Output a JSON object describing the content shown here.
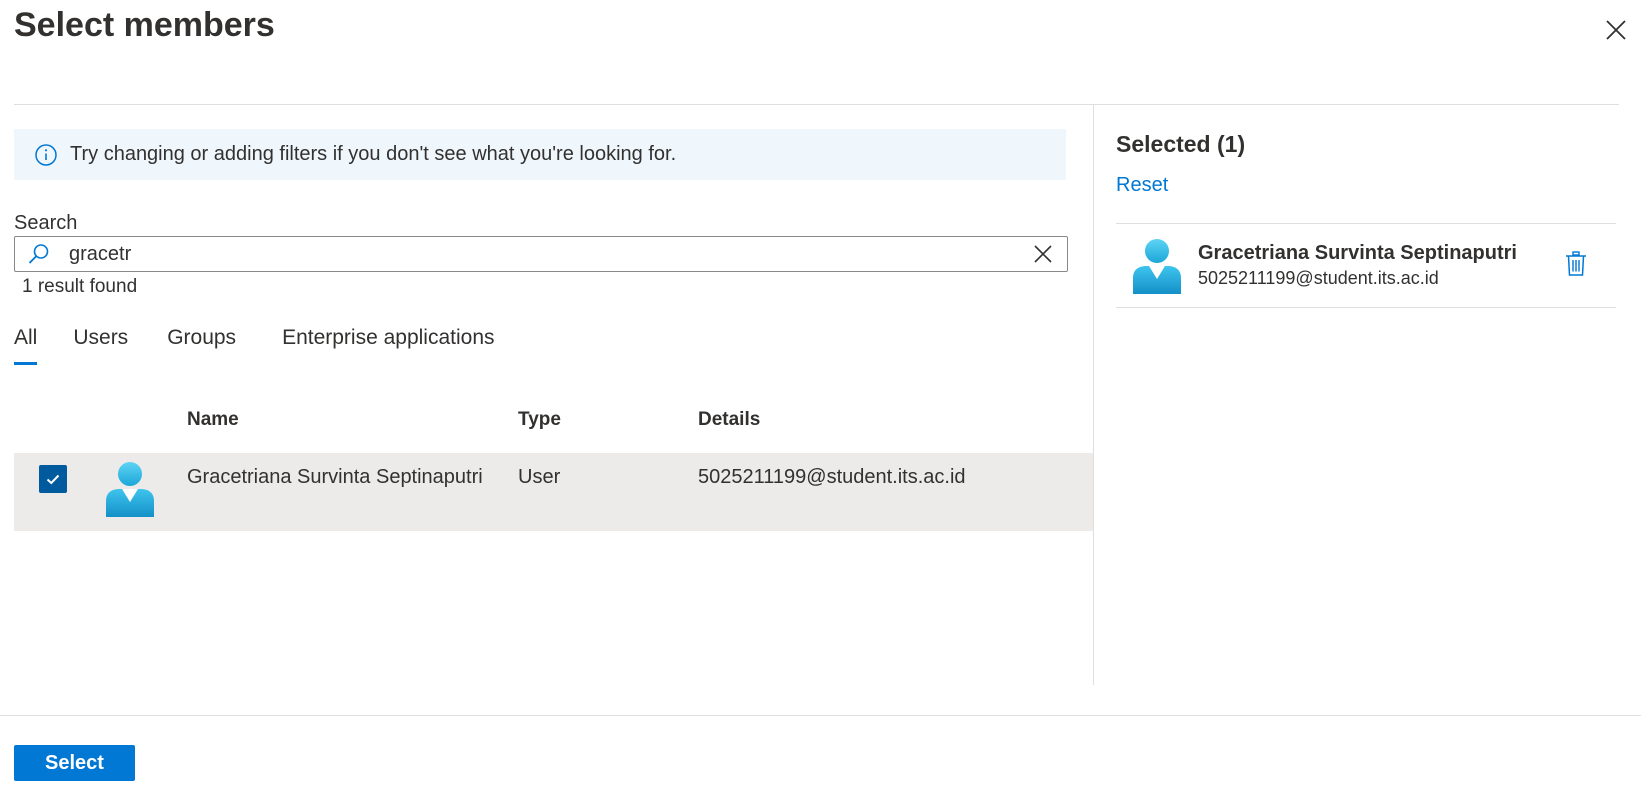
{
  "dialog": {
    "title": "Select members"
  },
  "info": {
    "text": "Try changing or adding filters if you don't see what you're looking for."
  },
  "search": {
    "label": "Search",
    "value": "gracetr",
    "result_count": "1 result found"
  },
  "tabs": [
    {
      "label": "All",
      "active": true
    },
    {
      "label": "Users",
      "active": false
    },
    {
      "label": "Groups",
      "active": false
    },
    {
      "label": "Enterprise applications",
      "active": false
    }
  ],
  "table": {
    "headers": {
      "name": "Name",
      "type": "Type",
      "details": "Details"
    },
    "rows": [
      {
        "checked": true,
        "name": "Gracetriana Survinta Septinaputri",
        "type": "User",
        "details": "5025211199@student.its.ac.id"
      }
    ]
  },
  "selected_panel": {
    "title": "Selected (1)",
    "reset_label": "Reset",
    "items": [
      {
        "name": "Gracetriana Survinta Septinaputri",
        "email": "5025211199@student.its.ac.id"
      }
    ]
  },
  "footer": {
    "select_label": "Select"
  },
  "colors": {
    "accent": "#0078d4",
    "checkbox": "#005a9e",
    "row_selected": "#edebe9",
    "info_bg": "#eff6fc"
  }
}
